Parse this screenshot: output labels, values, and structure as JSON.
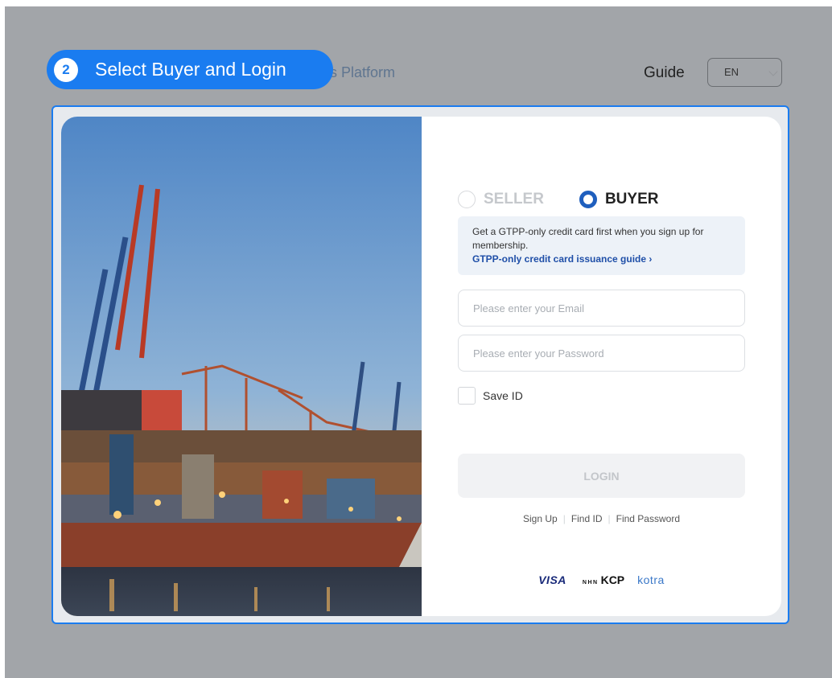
{
  "header": {
    "platform_fragment": "s Platform",
    "guide_label": "Guide",
    "language": "EN"
  },
  "step": {
    "number": "2",
    "label": "Select Buyer and Login"
  },
  "login": {
    "roles": [
      {
        "label": "SELLER",
        "selected": false
      },
      {
        "label": "BUYER",
        "selected": true
      }
    ],
    "notice_text": "Get a GTPP-only credit card first when you sign up for membership.",
    "notice_link": "GTPP-only credit card issuance guide",
    "notice_link_arrow": "›",
    "email_placeholder": "Please enter your Email",
    "password_placeholder": "Please enter your Password",
    "save_id_label": "Save ID",
    "login_button": "LOGIN",
    "links": [
      "Sign Up",
      "Find ID",
      "Find Password"
    ],
    "separator": "|"
  },
  "partners": {
    "visa": "VISA",
    "nhn": "NHN",
    "kcp": "KCP",
    "kotra": "kotra"
  },
  "colors": {
    "accent": "#1a7cf0",
    "buyer_radio": "#1f5fbe",
    "link": "#1f4fa8",
    "overlay": "#a2a5a9"
  }
}
